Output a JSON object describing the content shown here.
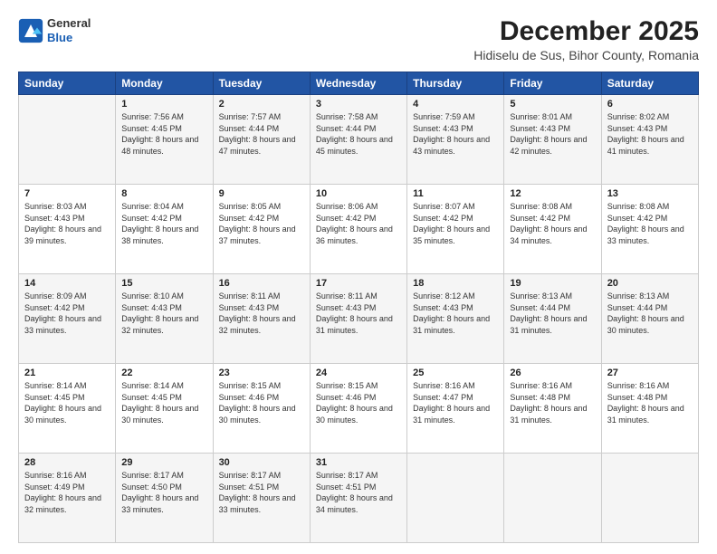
{
  "header": {
    "logo_general": "General",
    "logo_blue": "Blue",
    "main_title": "December 2025",
    "subtitle": "Hidiselu de Sus, Bihor County, Romania"
  },
  "columns": [
    "Sunday",
    "Monday",
    "Tuesday",
    "Wednesday",
    "Thursday",
    "Friday",
    "Saturday"
  ],
  "weeks": [
    [
      {
        "day": "",
        "sunrise": "",
        "sunset": "",
        "daylight": ""
      },
      {
        "day": "1",
        "sunrise": "Sunrise: 7:56 AM",
        "sunset": "Sunset: 4:45 PM",
        "daylight": "Daylight: 8 hours and 48 minutes."
      },
      {
        "day": "2",
        "sunrise": "Sunrise: 7:57 AM",
        "sunset": "Sunset: 4:44 PM",
        "daylight": "Daylight: 8 hours and 47 minutes."
      },
      {
        "day": "3",
        "sunrise": "Sunrise: 7:58 AM",
        "sunset": "Sunset: 4:44 PM",
        "daylight": "Daylight: 8 hours and 45 minutes."
      },
      {
        "day": "4",
        "sunrise": "Sunrise: 7:59 AM",
        "sunset": "Sunset: 4:43 PM",
        "daylight": "Daylight: 8 hours and 43 minutes."
      },
      {
        "day": "5",
        "sunrise": "Sunrise: 8:01 AM",
        "sunset": "Sunset: 4:43 PM",
        "daylight": "Daylight: 8 hours and 42 minutes."
      },
      {
        "day": "6",
        "sunrise": "Sunrise: 8:02 AM",
        "sunset": "Sunset: 4:43 PM",
        "daylight": "Daylight: 8 hours and 41 minutes."
      }
    ],
    [
      {
        "day": "7",
        "sunrise": "Sunrise: 8:03 AM",
        "sunset": "Sunset: 4:43 PM",
        "daylight": "Daylight: 8 hours and 39 minutes."
      },
      {
        "day": "8",
        "sunrise": "Sunrise: 8:04 AM",
        "sunset": "Sunset: 4:42 PM",
        "daylight": "Daylight: 8 hours and 38 minutes."
      },
      {
        "day": "9",
        "sunrise": "Sunrise: 8:05 AM",
        "sunset": "Sunset: 4:42 PM",
        "daylight": "Daylight: 8 hours and 37 minutes."
      },
      {
        "day": "10",
        "sunrise": "Sunrise: 8:06 AM",
        "sunset": "Sunset: 4:42 PM",
        "daylight": "Daylight: 8 hours and 36 minutes."
      },
      {
        "day": "11",
        "sunrise": "Sunrise: 8:07 AM",
        "sunset": "Sunset: 4:42 PM",
        "daylight": "Daylight: 8 hours and 35 minutes."
      },
      {
        "day": "12",
        "sunrise": "Sunrise: 8:08 AM",
        "sunset": "Sunset: 4:42 PM",
        "daylight": "Daylight: 8 hours and 34 minutes."
      },
      {
        "day": "13",
        "sunrise": "Sunrise: 8:08 AM",
        "sunset": "Sunset: 4:42 PM",
        "daylight": "Daylight: 8 hours and 33 minutes."
      }
    ],
    [
      {
        "day": "14",
        "sunrise": "Sunrise: 8:09 AM",
        "sunset": "Sunset: 4:42 PM",
        "daylight": "Daylight: 8 hours and 33 minutes."
      },
      {
        "day": "15",
        "sunrise": "Sunrise: 8:10 AM",
        "sunset": "Sunset: 4:43 PM",
        "daylight": "Daylight: 8 hours and 32 minutes."
      },
      {
        "day": "16",
        "sunrise": "Sunrise: 8:11 AM",
        "sunset": "Sunset: 4:43 PM",
        "daylight": "Daylight: 8 hours and 32 minutes."
      },
      {
        "day": "17",
        "sunrise": "Sunrise: 8:11 AM",
        "sunset": "Sunset: 4:43 PM",
        "daylight": "Daylight: 8 hours and 31 minutes."
      },
      {
        "day": "18",
        "sunrise": "Sunrise: 8:12 AM",
        "sunset": "Sunset: 4:43 PM",
        "daylight": "Daylight: 8 hours and 31 minutes."
      },
      {
        "day": "19",
        "sunrise": "Sunrise: 8:13 AM",
        "sunset": "Sunset: 4:44 PM",
        "daylight": "Daylight: 8 hours and 31 minutes."
      },
      {
        "day": "20",
        "sunrise": "Sunrise: 8:13 AM",
        "sunset": "Sunset: 4:44 PM",
        "daylight": "Daylight: 8 hours and 30 minutes."
      }
    ],
    [
      {
        "day": "21",
        "sunrise": "Sunrise: 8:14 AM",
        "sunset": "Sunset: 4:45 PM",
        "daylight": "Daylight: 8 hours and 30 minutes."
      },
      {
        "day": "22",
        "sunrise": "Sunrise: 8:14 AM",
        "sunset": "Sunset: 4:45 PM",
        "daylight": "Daylight: 8 hours and 30 minutes."
      },
      {
        "day": "23",
        "sunrise": "Sunrise: 8:15 AM",
        "sunset": "Sunset: 4:46 PM",
        "daylight": "Daylight: 8 hours and 30 minutes."
      },
      {
        "day": "24",
        "sunrise": "Sunrise: 8:15 AM",
        "sunset": "Sunset: 4:46 PM",
        "daylight": "Daylight: 8 hours and 30 minutes."
      },
      {
        "day": "25",
        "sunrise": "Sunrise: 8:16 AM",
        "sunset": "Sunset: 4:47 PM",
        "daylight": "Daylight: 8 hours and 31 minutes."
      },
      {
        "day": "26",
        "sunrise": "Sunrise: 8:16 AM",
        "sunset": "Sunset: 4:48 PM",
        "daylight": "Daylight: 8 hours and 31 minutes."
      },
      {
        "day": "27",
        "sunrise": "Sunrise: 8:16 AM",
        "sunset": "Sunset: 4:48 PM",
        "daylight": "Daylight: 8 hours and 31 minutes."
      }
    ],
    [
      {
        "day": "28",
        "sunrise": "Sunrise: 8:16 AM",
        "sunset": "Sunset: 4:49 PM",
        "daylight": "Daylight: 8 hours and 32 minutes."
      },
      {
        "day": "29",
        "sunrise": "Sunrise: 8:17 AM",
        "sunset": "Sunset: 4:50 PM",
        "daylight": "Daylight: 8 hours and 33 minutes."
      },
      {
        "day": "30",
        "sunrise": "Sunrise: 8:17 AM",
        "sunset": "Sunset: 4:51 PM",
        "daylight": "Daylight: 8 hours and 33 minutes."
      },
      {
        "day": "31",
        "sunrise": "Sunrise: 8:17 AM",
        "sunset": "Sunset: 4:51 PM",
        "daylight": "Daylight: 8 hours and 34 minutes."
      },
      {
        "day": "",
        "sunrise": "",
        "sunset": "",
        "daylight": ""
      },
      {
        "day": "",
        "sunrise": "",
        "sunset": "",
        "daylight": ""
      },
      {
        "day": "",
        "sunrise": "",
        "sunset": "",
        "daylight": ""
      }
    ]
  ]
}
